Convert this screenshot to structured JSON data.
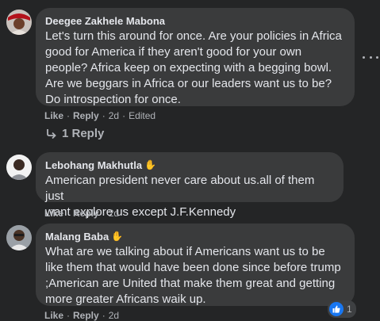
{
  "comments": [
    {
      "author": "Deegee Zakhele Mabona",
      "has_wave": false,
      "lines": [
        "Let's turn this around for once. Are your policies in Africa",
        "good for America if they aren't good for your own",
        "people? Africa keep on expecting with a begging bowl.",
        "Are we beggars in Africa or our leaders want us to be?",
        "Do introspection for once."
      ],
      "like": "Like",
      "reply": "Reply",
      "time": "2d",
      "edited": "Edited"
    },
    {
      "author": "Lebohang Makhutla",
      "has_wave": true,
      "lines": [
        "American president never care about us.all of them just",
        "want explore us except J.F.Kennedy"
      ],
      "like": "Like",
      "reply": "Reply",
      "time": "2d"
    },
    {
      "author": "Malang Baba",
      "has_wave": true,
      "lines": [
        "What are we talking about if Americans want us to be",
        "like them that would have been done since before trump",
        ";American are United that make them great and getting",
        "more greater Africans waik up."
      ],
      "like": "Like",
      "reply": "Reply",
      "time": "2d",
      "reaction_count": "1"
    }
  ],
  "replies_label": "1 Reply",
  "separator": "·",
  "wave_glyph": "✋",
  "icons": {
    "more": "more-options-icon",
    "reply_arrow": "reply-arrow-icon",
    "reaction": "like-reaction-icon"
  },
  "colors": {
    "background": "#242526",
    "bubble": "#3a3b3c",
    "text": "#e4e6eb",
    "secondary": "#b0b3b8",
    "like_blue": "#1877f2"
  }
}
